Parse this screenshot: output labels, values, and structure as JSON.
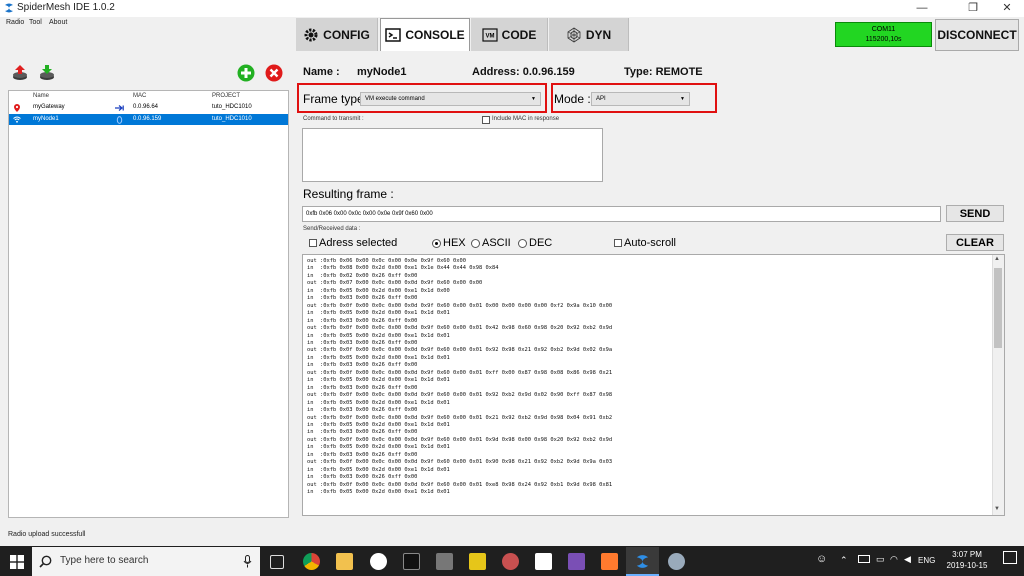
{
  "window": {
    "title": "SpiderMesh IDE 1.0.2",
    "minimize": "—",
    "maximize": "❐",
    "close": "✕"
  },
  "menu": [
    "Radio",
    "Tool",
    "About"
  ],
  "tabs": [
    {
      "label": "CONFIG",
      "icon": "gear-icon"
    },
    {
      "label": "CONSOLE",
      "icon": "terminal-icon"
    },
    {
      "label": "CODE",
      "icon": "vm-icon"
    },
    {
      "label": "DYN",
      "icon": "network-icon"
    }
  ],
  "connection": {
    "port": "COM11",
    "baud": "115200,10s",
    "disconnect_label": "DISCONNECT",
    "status_color": "#22d622"
  },
  "nodes": {
    "headers": [
      "Name",
      "MAC",
      "PROJECT"
    ],
    "rows": [
      {
        "name": "myGateway",
        "mac": "0.0.96.64",
        "project": "tuto_HDC1010",
        "selected": false
      },
      {
        "name": "myNode1",
        "mac": "0.0.96.159",
        "project": "tuto_HDC1010",
        "selected": true
      }
    ]
  },
  "node_info": {
    "name_label": "Name :",
    "name_value": "myNode1",
    "address": "Address: 0.0.96.159",
    "type": "Type: REMOTE"
  },
  "frame": {
    "type_label": "Frame type",
    "type_value": "VM execute command",
    "mode_label": "Mode :",
    "mode_value": "API",
    "command_label": "Command to transmit :",
    "include_mac_label": "Include MAC in response",
    "resulting_label": "Resulting frame :",
    "resulting_value": "0xfb 0x06 0x00 0x0c 0x00 0x0e 0x9f 0x60 0x00",
    "send_label": "SEND"
  },
  "received": {
    "section_label": "Send/Received data :",
    "address_selected_label": "Adress selected",
    "hex_label": "HEX",
    "ascii_label": "ASCII",
    "dec_label": "DEC",
    "autoscroll_label": "Auto-scroll",
    "clear_label": "CLEAR",
    "lines": [
      "out :0xfb 0x06 0x00 0x0c 0x00 0x0e 0x9f 0x60 0x00",
      "in  :0xfb 0x08 0x00 0x2d 0x00 0xe1 0x1e 0x44 0x44 0x98 0x84",
      "in  :0xfb 0x02 0x00 0x26 0xff 0x00",
      "out :0xfb 0x07 0x00 0x0c 0x00 0x0d 0x9f 0x60 0x00 0x00",
      "in  :0xfb 0x05 0x00 0x2d 0x00 0xe1 0x1d 0x00",
      "in  :0xfb 0x03 0x00 0x26 0xff 0x00",
      "out :0xfb 0x0f 0x00 0x0c 0x00 0x0d 0x9f 0x60 0x00 0x01 0x00 0x00 0x00 0x00 0xf2 0x9a 0x10 0x00",
      "in  :0xfb 0x05 0x00 0x2d 0x00 0xe1 0x1d 0x01",
      "in  :0xfb 0x03 0x00 0x26 0xff 0x00",
      "out :0xfb 0x0f 0x00 0x0c 0x00 0x0d 0x9f 0x60 0x00 0x01 0x42 0x98 0x60 0x98 0x20 0x92 0xb2 0x9d",
      "in  :0xfb 0x05 0x00 0x2d 0x00 0xe1 0x1d 0x01",
      "in  :0xfb 0x03 0x00 0x26 0xff 0x00",
      "out :0xfb 0x0f 0x00 0x0c 0x00 0x0d 0x9f 0x60 0x00 0x01 0x92 0x98 0x21 0x92 0xb2 0x9d 0x02 0x9a",
      "in  :0xfb 0x05 0x00 0x2d 0x00 0xe1 0x1d 0x01",
      "in  :0xfb 0x03 0x00 0x26 0xff 0x00",
      "out :0xfb 0x0f 0x00 0x0c 0x00 0x0d 0x9f 0x60 0x00 0x01 0xff 0x00 0x87 0x98 0x08 0x86 0x98 0x21",
      "in  :0xfb 0x05 0x00 0x2d 0x00 0xe1 0x1d 0x01",
      "in  :0xfb 0x03 0x00 0x26 0xff 0x00",
      "out :0xfb 0x0f 0x00 0x0c 0x00 0x0d 0x9f 0x60 0x00 0x01 0x92 0xb2 0x9d 0x02 0x90 0xff 0x87 0x98",
      "in  :0xfb 0x05 0x00 0x2d 0x00 0xe1 0x1d 0x01",
      "in  :0xfb 0x03 0x00 0x26 0xff 0x00",
      "out :0xfb 0x0f 0x00 0x0c 0x00 0x0d 0x9f 0x60 0x00 0x01 0x21 0x92 0xb2 0x9d 0x98 0x04 0x91 0xb2",
      "in  :0xfb 0x05 0x00 0x2d 0x00 0xe1 0x1d 0x01",
      "in  :0xfb 0x03 0x00 0x26 0xff 0x00",
      "out :0xfb 0x0f 0x00 0x0c 0x00 0x0d 0x9f 0x60 0x00 0x01 0x9d 0x98 0x00 0x98 0x20 0x92 0xb2 0x9d",
      "in  :0xfb 0x05 0x00 0x2d 0x00 0xe1 0x1d 0x01",
      "in  :0xfb 0x03 0x00 0x26 0xff 0x00",
      "out :0xfb 0x0f 0x00 0x0c 0x00 0x0d 0x9f 0x60 0x00 0x01 0x90 0x98 0x21 0x92 0xb2 0x9d 0x9a 0x03",
      "in  :0xfb 0x05 0x00 0x2d 0x00 0xe1 0x1d 0x01",
      "in  :0xfb 0x03 0x00 0x26 0xff 0x00",
      "out :0xfb 0x0f 0x00 0x0c 0x00 0x0d 0x9f 0x60 0x00 0x01 0xe8 0x98 0x24 0x92 0xb1 0x9d 0x98 0x81",
      "in  :0xfb 0x05 0x00 0x2d 0x00 0xe1 0x1d 0x01"
    ]
  },
  "status_bar": "Radio upload successfull",
  "taskbar": {
    "search_placeholder": "Type here to search",
    "language": "ENG",
    "time": "3:07 PM",
    "date": "2019-10-15"
  }
}
